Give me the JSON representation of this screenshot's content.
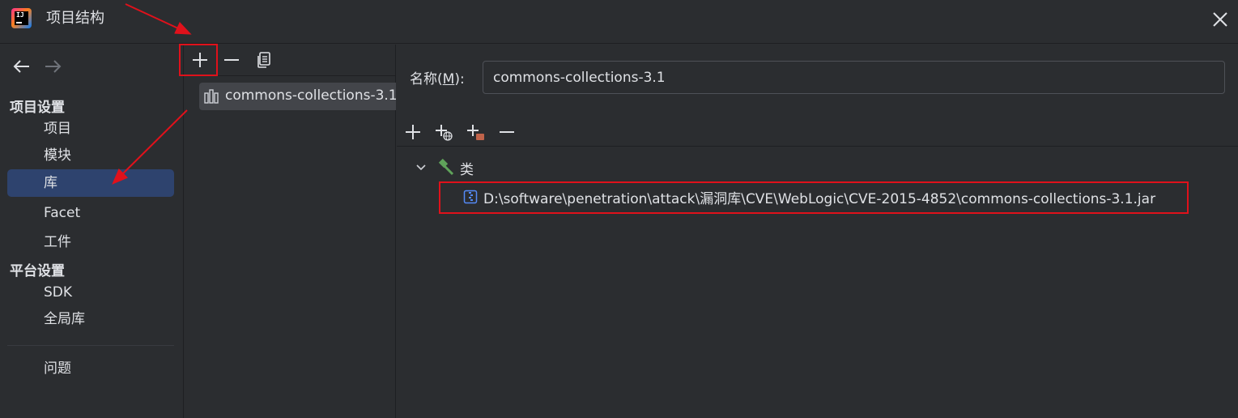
{
  "window": {
    "title": "项目结构",
    "close_icon": "close-icon",
    "logo_text": "IJ"
  },
  "sidebar": {
    "nav": {
      "back_icon": "arrow-left-icon",
      "forward_icon": "arrow-right-icon"
    },
    "project_settings_header": "项目设置",
    "project_items": [
      {
        "label": "项目"
      },
      {
        "label": "模块"
      },
      {
        "label": "库",
        "selected": true
      },
      {
        "label": "Facet"
      },
      {
        "label": "工件"
      }
    ],
    "platform_settings_header": "平台设置",
    "platform_items": [
      {
        "label": "SDK"
      },
      {
        "label": "全局库"
      }
    ],
    "problems_label": "问题"
  },
  "libraries": {
    "toolbar": {
      "add_icon": "plus-icon",
      "remove_icon": "minus-icon",
      "copy_icon": "copy-icon"
    },
    "items": [
      {
        "label": "commons-collections-3.1",
        "icon": "library-icon"
      }
    ]
  },
  "details": {
    "name_label_prefix": "名称(",
    "name_label_mnemonic": "M",
    "name_label_suffix": "):",
    "name_value": "commons-collections-3.1",
    "toolbar": {
      "add_icon": "plus-icon",
      "add_url_icon": "plus-globe-icon",
      "add_jar_icon": "plus-folder-icon",
      "remove_icon": "minus-icon"
    },
    "tree": {
      "classes_label": "类",
      "classes_icon": "hammer-icon",
      "jar_path": "D:\\software\\penetration\\attack\\漏洞库\\CVE\\WebLogic\\CVE-2015-4852\\commons-collections-3.1.jar",
      "jar_icon": "archive-icon"
    }
  },
  "colors": {
    "background": "#2b2d30",
    "selection": "#2e436e",
    "text": "#dfe1e5",
    "annotation": "#e0111b"
  }
}
